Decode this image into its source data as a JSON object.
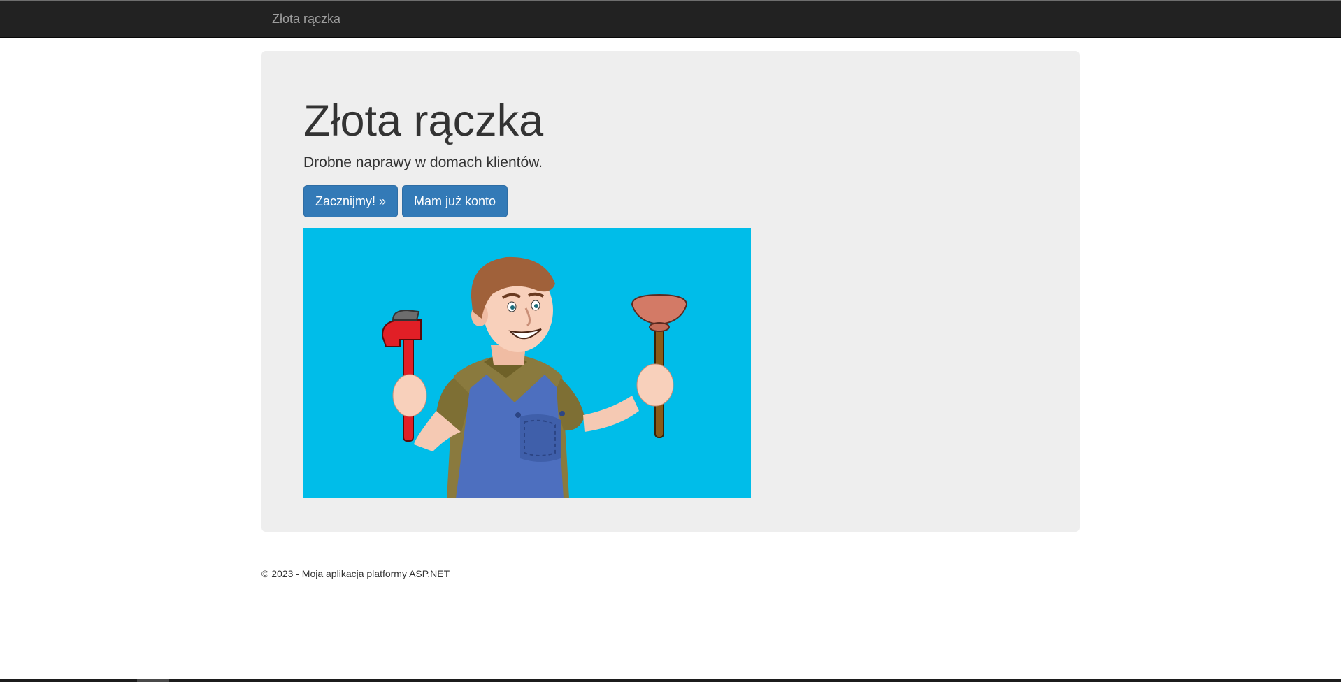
{
  "navbar": {
    "brand": "Złota rączka"
  },
  "jumbotron": {
    "title": "Złota rączka",
    "lead": "Drobne naprawy w domach klientów.",
    "start_button": "Zacznijmy! »",
    "login_button": "Mam już konto",
    "background_color": "#00bde9"
  },
  "footer": {
    "text": "© 2023 - Moja aplikacja platformy ASP.NET"
  },
  "colors": {
    "navbar": "#222222",
    "jumbotron": "#eeeeee",
    "primary": "#337ab7"
  }
}
